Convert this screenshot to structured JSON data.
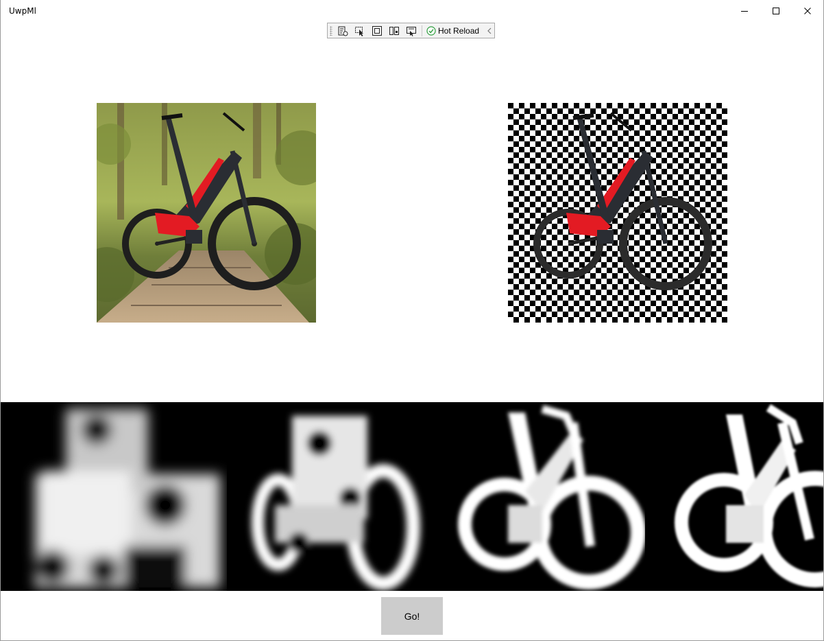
{
  "window": {
    "title": "UwpMl",
    "controls": [
      "minimize-icon",
      "maximize-icon",
      "close-icon"
    ]
  },
  "hot_reload_toolbar": {
    "tools": [
      "go-to-live-visual-tree-icon",
      "select-element-icon",
      "display-layout-adorners-icon",
      "track-focus-icon",
      "binding-failures-icon"
    ],
    "status_icon": "check-circle-icon",
    "status_label": "Hot Reload",
    "collapse_icon": "chevron-left-icon"
  },
  "images": {
    "source": "bike-photo",
    "result": "bike-cutout-on-checkerboard"
  },
  "masks": [
    "segmentation-mask-stage-1",
    "segmentation-mask-stage-2",
    "segmentation-mask-stage-3",
    "segmentation-mask-stage-4"
  ],
  "actions": {
    "go_label": "Go!"
  },
  "colors": {
    "button_bg": "#cccccc",
    "mask_bg": "#000000",
    "hot_reload_ok": "#2e9e3e",
    "frame_red": "#e31b23"
  }
}
